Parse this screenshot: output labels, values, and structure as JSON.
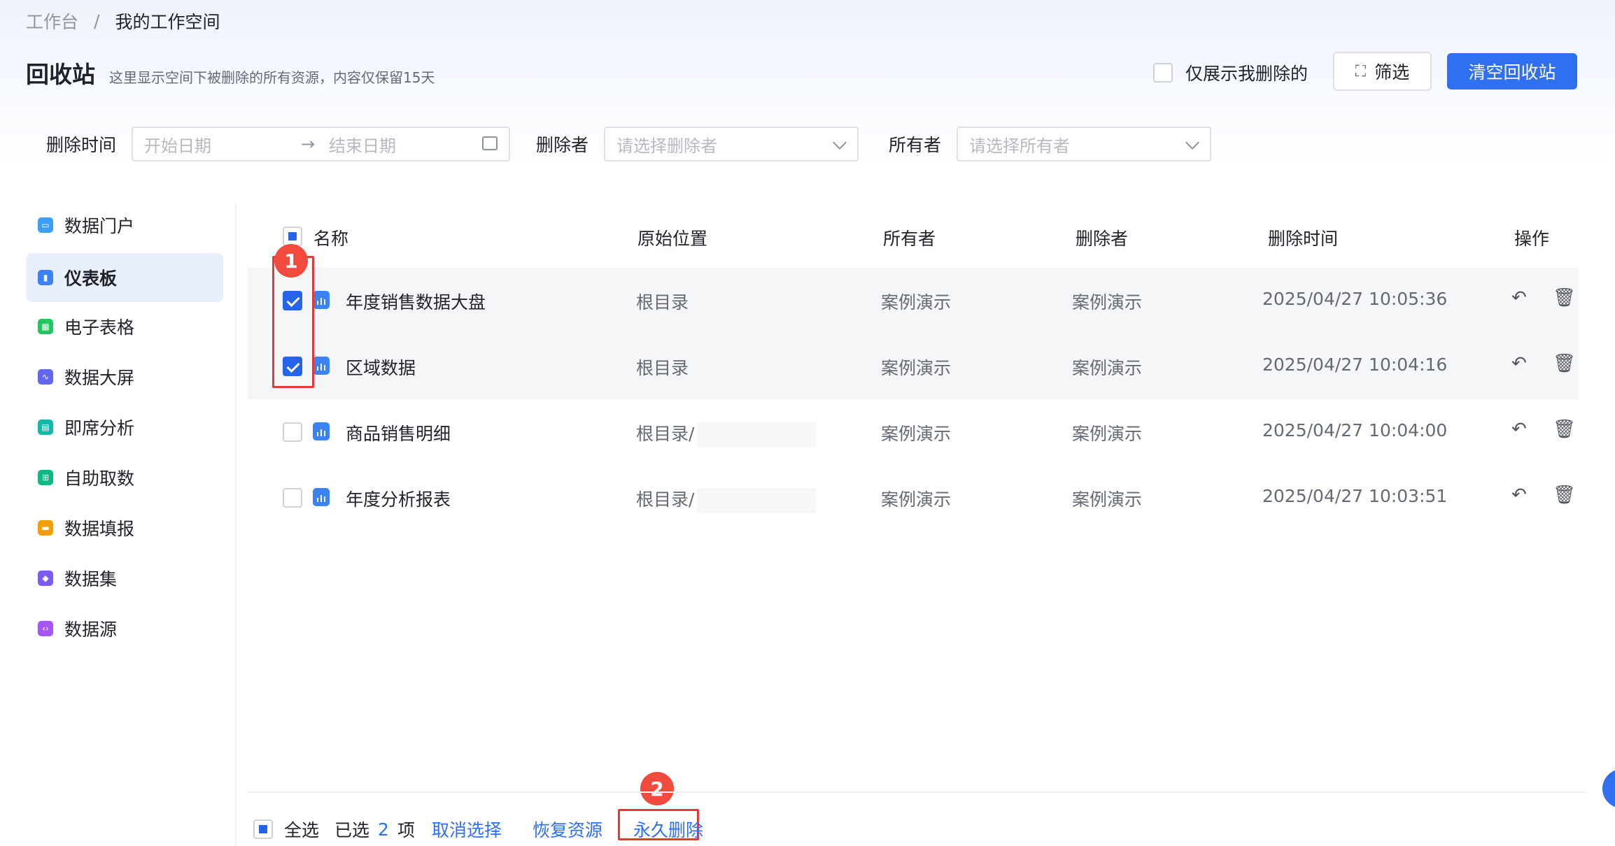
{
  "breadcrumb": {
    "root": "工作台",
    "separator": "/",
    "current": "我的工作空间"
  },
  "header": {
    "title": "回收站",
    "description": "这里显示空间下被删除的所有资源，内容仅保留15天",
    "only_mine_label": "仅展示我删除的",
    "filter_label": "筛选",
    "empty_label": "清空回收站"
  },
  "filters": {
    "delete_time_label": "删除时间",
    "start_placeholder": "开始日期",
    "arrow": "→",
    "end_placeholder": "结束日期",
    "deleter_label": "删除者",
    "deleter_placeholder": "请选择删除者",
    "owner_label": "所有者",
    "owner_placeholder": "请选择所有者"
  },
  "sidebar": {
    "items": [
      {
        "label": "数据门户",
        "icon": "portal-icon",
        "color": "#3b9ef7"
      },
      {
        "label": "仪表板",
        "icon": "dashboard-icon",
        "color": "#3b82f6"
      },
      {
        "label": "电子表格",
        "icon": "spreadsheet-icon",
        "color": "#22c55e"
      },
      {
        "label": "数据大屏",
        "icon": "big-screen-icon",
        "color": "#6366f1"
      },
      {
        "label": "即席分析",
        "icon": "adhoc-analysis-icon",
        "color": "#14b8a6"
      },
      {
        "label": "自助取数",
        "icon": "self-service-icon",
        "color": "#10b981"
      },
      {
        "label": "数据填报",
        "icon": "data-fill-icon",
        "color": "#f59e0b"
      },
      {
        "label": "数据集",
        "icon": "dataset-icon",
        "color": "#7c5cf0"
      },
      {
        "label": "数据源",
        "icon": "datasource-icon",
        "color": "#a855f7"
      }
    ],
    "active_index": 1
  },
  "table": {
    "columns": [
      "名称",
      "原始位置",
      "所有者",
      "删除者",
      "删除时间",
      "操作"
    ],
    "rows": [
      {
        "name": "年度销售数据大盘",
        "location": "根目录",
        "owner": "案例演示",
        "deleter": "案例演示",
        "deleted_at": "2025/04/27 10:05:36",
        "selected": true
      },
      {
        "name": "区域数据",
        "location": "根目录",
        "owner": "案例演示",
        "deleter": "案例演示",
        "deleted_at": "2025/04/27 10:04:16",
        "selected": true
      },
      {
        "name": "商品销售明细",
        "location": "根目录/",
        "owner": "案例演示",
        "deleter": "案例演示",
        "deleted_at": "2025/04/27 10:04:00",
        "selected": false
      },
      {
        "name": "年度分析报表",
        "location": "根目录/",
        "owner": "案例演示",
        "deleter": "案例演示",
        "deleted_at": "2025/04/27 10:03:51",
        "selected": false
      }
    ]
  },
  "annotations": {
    "step1": "1",
    "step2": "2"
  },
  "footer": {
    "select_all": "全选",
    "selected_prefix": "已选",
    "selected_count": "2",
    "selected_suffix": "项",
    "cancel_selection": "取消选择",
    "restore": "恢复资源",
    "permanent_delete": "永久删除"
  },
  "colors": {
    "accent": "#2f6ff2",
    "annotation": "#e53935"
  }
}
